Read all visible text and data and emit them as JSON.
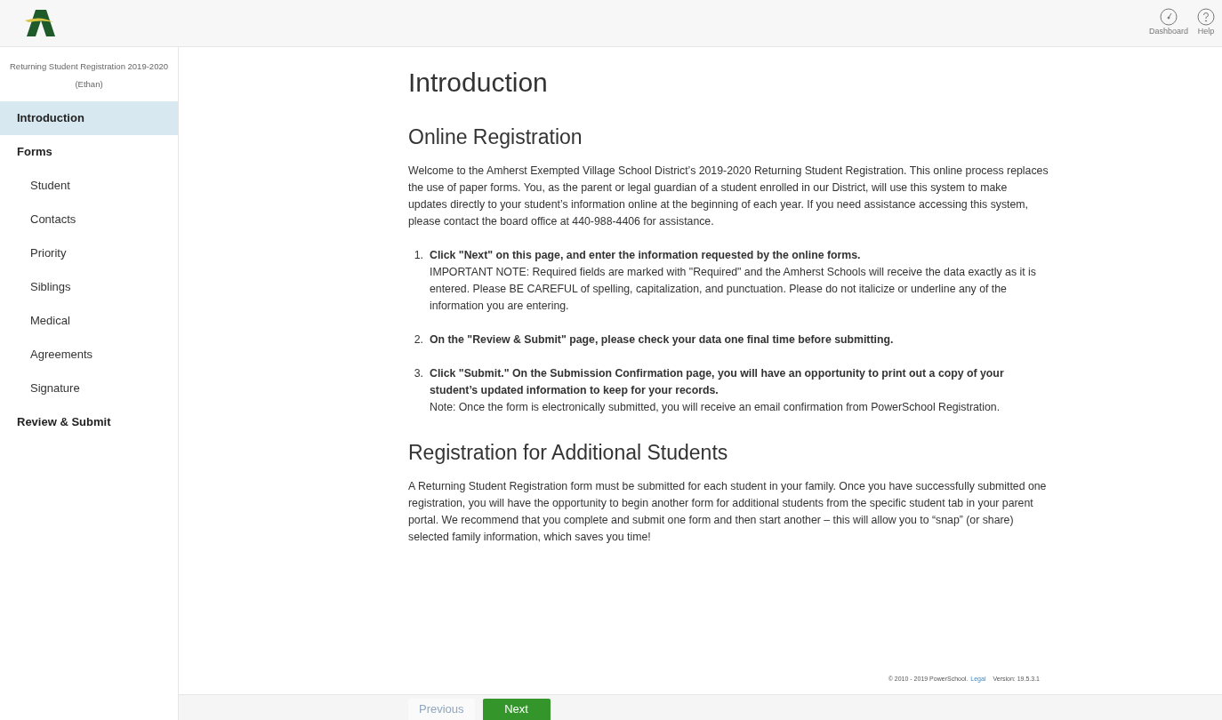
{
  "header": {
    "actions": [
      {
        "kind": "dashboard",
        "label": "Dashboard"
      },
      {
        "kind": "help",
        "label": "Help"
      }
    ]
  },
  "sidebar": {
    "title": "Returning Student Registration 2019-2020 (Ethan)",
    "items": [
      {
        "label": "Introduction",
        "selected": true
      },
      {
        "label": "Forms",
        "selected": false,
        "children": [
          {
            "label": "Student",
            "selected": false
          },
          {
            "label": "Contacts",
            "selected": false
          },
          {
            "label": "Priority",
            "selected": false
          },
          {
            "label": "Siblings",
            "selected": false
          },
          {
            "label": "Medical",
            "selected": false
          },
          {
            "label": "Agreements",
            "selected": false
          },
          {
            "label": "Signature",
            "selected": false
          }
        ]
      },
      {
        "label": "Review & Submit",
        "selected": false
      }
    ]
  },
  "page_title": "Introduction",
  "sections": [
    {
      "heading": "Online Registration",
      "paragraph": "Welcome to the Amherst Exempted Village School District’s 2019-2020 Returning Student Registration. This online process replaces the use of paper forms. You, as the parent or legal guardian of a student enrolled in our District, will use this system to make updates directly to your student’s information online at the beginning of each year. If you need assistance accessing this system, please contact the board office at 440-988-4406 for assistance.",
      "steps": [
        {
          "number": "1.",
          "title": "Click \"Next\" on this page, and enter the information requested by the online forms.",
          "note": "IMPORTANT NOTE: Required fields are marked with \"Required\" and the Amherst Schools will receive the data exactly as it is entered. Please BE CAREFUL of spelling, capitalization, and punctuation. Please do not italicize or underline any of the information you are entering."
        },
        {
          "number": "2.",
          "title": "On the \"Review & Submit\" page, please check your data one final time before submitting."
        },
        {
          "number": "3.",
          "title": "Click \"Submit.\" On the Submission Confirmation page, you will have an opportunity to print out a copy of your student’s updated information to keep for your records.",
          "note": "Note: Once the form is electronically submitted, you will receive an email confirmation from PowerSchool Registration."
        }
      ]
    },
    {
      "heading": "Registration for Additional Students",
      "paragraph": "A Returning Student Registration form must be submitted for each student in your family. Once you have successfully submitted one registration, you will have the opportunity to begin another form for additional students from the specific student tab in your parent portal. We recommend that you complete and submit one form and then start another – this will allow you to “snap” (or share) selected family information, which saves you time!"
    }
  ],
  "footer": {
    "copyright": "© 2010 - 2019 PowerSchool.",
    "legal_link": "Legal",
    "version": "Version: 19.5.3.1"
  },
  "buttons": [
    {
      "label": "Previous",
      "disabled": true
    },
    {
      "label": "Next",
      "disabled": false
    }
  ]
}
